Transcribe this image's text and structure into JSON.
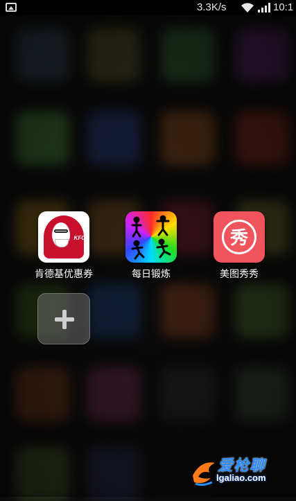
{
  "status_bar": {
    "network_speed": "3.3K/s",
    "time": "10:1"
  },
  "folder": {
    "apps": [
      {
        "name": "肯德基优惠券",
        "icon": "kfc-colonel-icon"
      },
      {
        "name": "每日锻炼",
        "icon": "workout-figures-icon"
      },
      {
        "name": "美图秀秀",
        "icon": "meitu-xiu-icon",
        "icon_text": "秀"
      }
    ],
    "add_button_icon": "plus-icon"
  },
  "watermark": {
    "title": "爱枪聊",
    "url": "lgaliao.com"
  },
  "colors": {
    "kfc_red": "#c8102e",
    "meitu_pink": "#f0555e",
    "watermark_blue": "#2a8cff"
  }
}
